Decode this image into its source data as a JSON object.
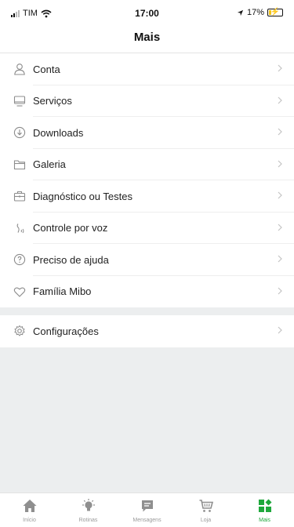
{
  "status_bar": {
    "carrier": "TIM",
    "time": "17:00",
    "battery": "17%"
  },
  "header": {
    "title": "Mais"
  },
  "menu": {
    "items": [
      {
        "label": "Conta",
        "icon": "user-icon"
      },
      {
        "label": "Serviços",
        "icon": "monitor-icon"
      },
      {
        "label": "Downloads",
        "icon": "download-circle-icon"
      },
      {
        "label": "Galeria",
        "icon": "folder-icon"
      },
      {
        "label": "Diagnóstico ou Testes",
        "icon": "toolbox-icon"
      },
      {
        "label": "Controle por voz",
        "icon": "voice-icon"
      },
      {
        "label": "Preciso de ajuda",
        "icon": "help-circle-icon"
      },
      {
        "label": "Família Mibo",
        "icon": "heart-icon"
      }
    ],
    "settings": {
      "label": "Configurações",
      "icon": "gear-icon"
    }
  },
  "tab_bar": {
    "tabs": [
      {
        "label": "Início",
        "icon": "home-icon",
        "active": false
      },
      {
        "label": "Rotinas",
        "icon": "bulb-icon",
        "active": false
      },
      {
        "label": "Mensagens",
        "icon": "message-icon",
        "active": false
      },
      {
        "label": "Loja",
        "icon": "cart-icon",
        "active": false
      },
      {
        "label": "Mais",
        "icon": "more-grid-icon",
        "active": true
      }
    ],
    "active_color": "#1fa83c",
    "inactive_color": "#8f8f8f"
  }
}
